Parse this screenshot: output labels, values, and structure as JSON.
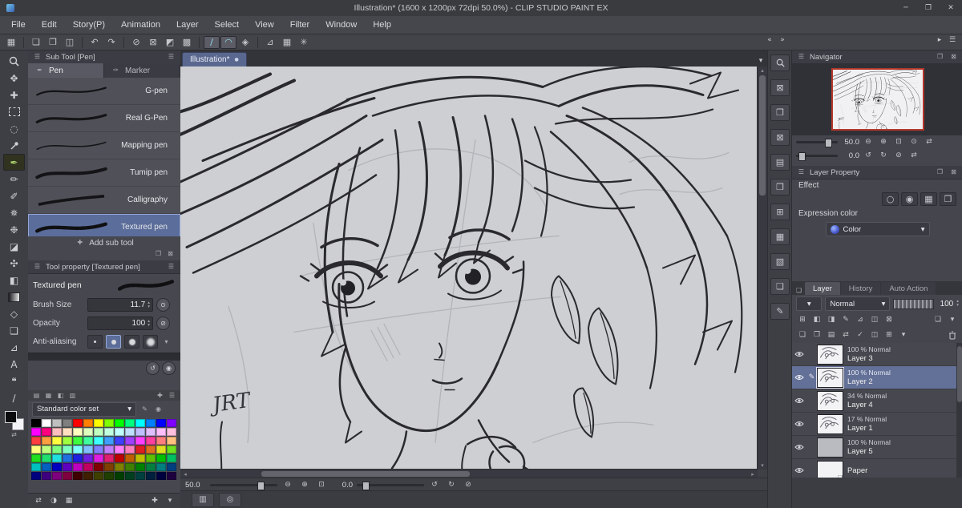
{
  "window": {
    "title": "Illustration* (1600 x 1200px 72dpi 50.0%)  - CLIP STUDIO PAINT EX"
  },
  "menu": {
    "items": [
      "File",
      "Edit",
      "Story(P)",
      "Animation",
      "Layer",
      "Select",
      "View",
      "Filter",
      "Window",
      "Help"
    ]
  },
  "canvas": {
    "tab": "Illustration*"
  },
  "status": {
    "zoom": "50.0",
    "rotation": "0.0"
  },
  "subtool": {
    "header": "Sub Tool [Pen]",
    "tabs": [
      "Pen",
      "Marker"
    ],
    "brushes": [
      "G-pen",
      "Real G-Pen",
      "Mapping pen",
      "Tumip pen",
      "Calligraphy",
      "Textured pen"
    ],
    "add_label": "Add sub tool"
  },
  "toolprop": {
    "header": "Tool property [Textured pen]",
    "name": "Textured pen",
    "size_label": "Brush Size",
    "size_value": "11.7",
    "opacity_label": "Opacity",
    "opacity_value": "100",
    "aa_label": "Anti-aliasing"
  },
  "colorset": {
    "name": "Standard color set",
    "palette": [
      [
        "#000000",
        "#ffffff",
        "#bfbfbf",
        "#7f7f7f",
        "#ff0000",
        "#ff7f00",
        "#ffff00",
        "#7fff00",
        "#00ff00",
        "#00ff7f",
        "#00ffff",
        "#007fff",
        "#0000ff",
        "#7f00ff"
      ],
      [
        "#ff00ff",
        "#ff007f",
        "#ffbfbf",
        "#ffdfbf",
        "#ffffbf",
        "#dfffbf",
        "#bfffbf",
        "#bfffdf",
        "#bfffff",
        "#bfdfff",
        "#bfbfff",
        "#dfbfff",
        "#ffbfff",
        "#ffbfdf"
      ],
      [
        "#ff3f3f",
        "#ff9f3f",
        "#ffff3f",
        "#9fff3f",
        "#3fff3f",
        "#3fff9f",
        "#3fffff",
        "#3f9fff",
        "#3f3fff",
        "#9f3fff",
        "#ff3fff",
        "#ff3f9f",
        "#ff7f7f",
        "#ffbf7f"
      ],
      [
        "#ffff7f",
        "#bfff7f",
        "#7fff7f",
        "#7fffbf",
        "#7fffff",
        "#7fbfff",
        "#7f7fff",
        "#bf7fff",
        "#ff7fff",
        "#ff7fbf",
        "#df1f1f",
        "#df6f1f",
        "#dfdf1f",
        "#6fdf1f"
      ],
      [
        "#1fdf1f",
        "#1fdf6f",
        "#1fdfdf",
        "#1f6fdf",
        "#1f1fdf",
        "#6f1fdf",
        "#df1fdf",
        "#df1f6f",
        "#bf0000",
        "#bf5f00",
        "#bfbf00",
        "#5fbf00",
        "#00bf00",
        "#00bf5f"
      ],
      [
        "#00bfbf",
        "#005fbf",
        "#0000bf",
        "#5f00bf",
        "#bf00bf",
        "#bf005f",
        "#7f0000",
        "#7f3f00",
        "#7f7f00",
        "#3f7f00",
        "#007f00",
        "#007f3f",
        "#007f7f",
        "#003f7f"
      ],
      [
        "#00007f",
        "#3f007f",
        "#7f007f",
        "#7f003f",
        "#3f0000",
        "#3f1f00",
        "#3f3f00",
        "#1f3f00",
        "#003f00",
        "#003f1f",
        "#003f3f",
        "#001f3f",
        "#00003f",
        "#1f003f"
      ]
    ]
  },
  "nav": {
    "title": "Navigator",
    "zoom": "50.0",
    "rotation": "0.0"
  },
  "lprop": {
    "title": "Layer Property",
    "effect": "Effect",
    "expression": "Expression color",
    "color_mode": "Color"
  },
  "layers": {
    "tabs": [
      "Layer",
      "History",
      "Auto Action"
    ],
    "blend": "Normal",
    "opacity": "100",
    "items": [
      {
        "info": "100 % Normal",
        "name": "Layer 3"
      },
      {
        "info": "100 % Normal",
        "name": "Layer 2"
      },
      {
        "info": "34 % Normal",
        "name": "Layer 4"
      },
      {
        "info": "17 % Normal",
        "name": "Layer 1"
      },
      {
        "info": "100 % Normal",
        "name": "Layer 5"
      },
      {
        "info": "",
        "name": "Paper"
      }
    ]
  },
  "colors": {
    "selection": "#637097",
    "canvas_bg": "#cdcfd2",
    "nav_frame": "#b5372c",
    "tab": "#5a6890",
    "tool_active": "#a9d16b"
  },
  "icons": {
    "app": "◆",
    "min": "─",
    "max": "❐",
    "close": "✕",
    "menu": "☰",
    "chev_down": "▾",
    "chev_left": "«",
    "chev_right": "»",
    "expand": "▸",
    "new": "❏",
    "open": "❐",
    "save": "◫",
    "undo": "↶",
    "redo": "↷",
    "clear": "⊘",
    "deselect": "⊠",
    "invert": "◩",
    "fillsel": "▩",
    "snap_line": "∕",
    "snap_curve": "◠",
    "snap_special": "◈",
    "ruler": "⊿",
    "grid": "▦",
    "sym": "✳",
    "move": "✥",
    "operate": "✚",
    "lasso": "◌",
    "pen": "✒",
    "pencil": "✏",
    "brush": "✐",
    "airbrush": "✵",
    "deco": "❉",
    "eraser": "◪",
    "blend": "✣",
    "fill": "◧",
    "figure": "◇",
    "frame": "❏",
    "text_tool": "A",
    "balloon": "❝",
    "line": "∕",
    "swap": "⇄",
    "plus": "✚",
    "reg": "◉",
    "reset_small": "↺",
    "zoom_out": "⊖",
    "zoom_in": "⊕",
    "fit": "⊡",
    "actual": "⊙",
    "flip": "⇄",
    "rot_l": "↺",
    "rot_r": "↻",
    "reset": "⊘",
    "up": "▴",
    "down": "▾",
    "tab_pen": "✒",
    "tab_marker": "✑",
    "effect": [
      "○",
      "◉",
      "▦",
      "❐"
    ],
    "strip": [
      "⊠",
      "❐",
      "⊠",
      "▤",
      "❒",
      "⊞",
      "▦",
      "▧",
      "❏",
      "✎"
    ],
    "layer_lock": [
      "⊞",
      "◧",
      "◨",
      "✎",
      "⊿",
      "◫",
      "⊠"
    ],
    "layer_lock_r": [
      "❏",
      "▾"
    ],
    "layer_act": [
      "❏",
      "❐",
      "▤",
      "⇄",
      "✓",
      "◫",
      "⊞",
      "▾"
    ],
    "cs_tabs": [
      "▤",
      "▦",
      "◧",
      "▥"
    ],
    "cs_tabs_r": [
      "✚",
      "☰"
    ],
    "paper": "❏",
    "edit_pen": "✎",
    "dot": "●",
    "area": "▥",
    "crosshair": "◎",
    "halftone": "◑",
    "mini_dd": "▾"
  }
}
